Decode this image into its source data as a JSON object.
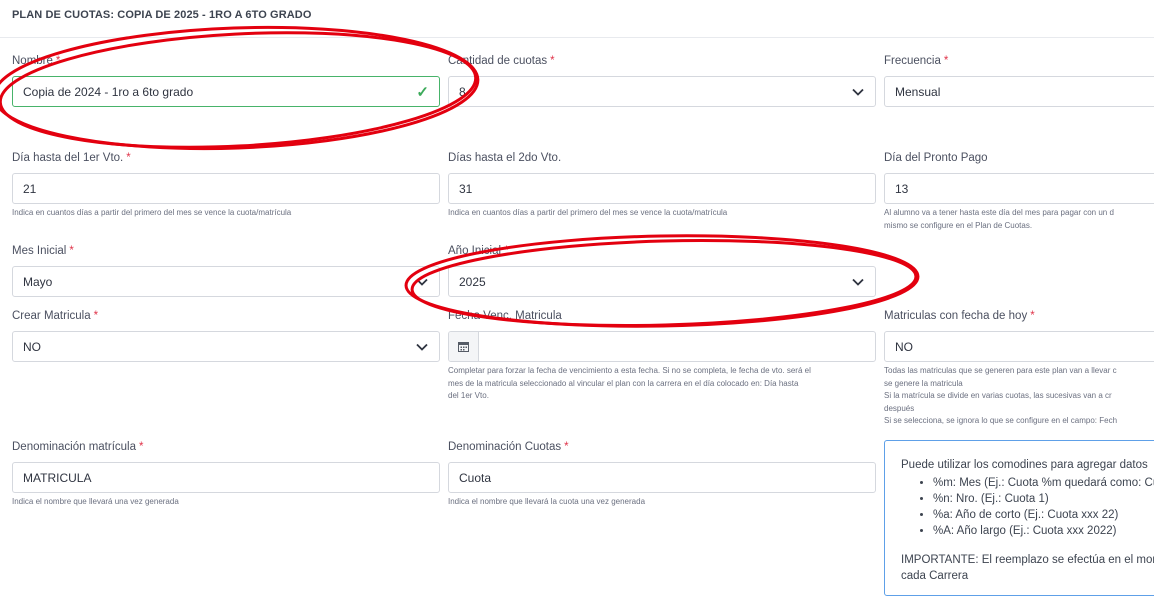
{
  "page": {
    "title": "PLAN DE CUOTAS: COPIA DE 2025 - 1RO A 6TO GRADO"
  },
  "fields": {
    "nombre": {
      "label": "Nombre",
      "required": "*",
      "value": "Copia de 2024 - 1ro a 6to grado"
    },
    "cantidad_cuotas": {
      "label": "Cantidad de cuotas",
      "required": "*",
      "value": "8"
    },
    "frecuencia": {
      "label": "Frecuencia",
      "required": "*",
      "value": "Mensual"
    },
    "dia_1er_vto": {
      "label": "Día hasta del 1er Vto.",
      "required": "*",
      "value": "21",
      "help": "Indica en cuantos días a partir del primero del mes se vence la cuota/matrícula"
    },
    "dias_2do_vto": {
      "label": "Días hasta el 2do Vto.",
      "value": "31",
      "help": "Indica en cuantos días a partir del primero del mes se vence la cuota/matrícula"
    },
    "dia_pronto_pago": {
      "label": "Día del Pronto Pago",
      "value": "13",
      "help_line1": "Al alumno va a tener hasta este día del mes para pagar con un d",
      "help_line2": "mismo se configure en el Plan de Cuotas."
    },
    "mes_inicial": {
      "label": "Mes Inicial",
      "required": "*",
      "value": "Mayo"
    },
    "anio_inicial": {
      "label": "Año Inicial",
      "required": "*",
      "value": "2025"
    },
    "crear_matricula": {
      "label": "Crear Matricula",
      "required": "*",
      "value": "NO"
    },
    "fecha_venc_matricula": {
      "label": "Fecha Venc. Matricula",
      "value": "",
      "help_line1": "Completar para forzar la fecha de vencimiento a esta fecha. Si no se completa, le fecha de vto. será el",
      "help_line2": "mes de la matricula seleccionado al vincular el plan con la carrera en el día colocado en: Día hasta",
      "help_line3": "del 1er Vto."
    },
    "matriculas_fecha_hoy": {
      "label": "Matriculas con fecha de hoy",
      "required": "*",
      "value": "NO",
      "help_line1": "Todas las matriculas que se generen para este plan van a llevar c",
      "help_line2": "se genere la matricula",
      "help_line3": "Si la matrícula se divide en varias cuotas, las sucesivas van a cr",
      "help_line4": "después",
      "help_line5": "Si se selecciona, se ignora lo que se configure en el campo: Fech"
    },
    "denominacion_matricula": {
      "label": "Denominación matrícula",
      "required": "*",
      "value": "MATRICULA",
      "help": "Indica el nombre que llevará una vez generada"
    },
    "denominacion_cuotas": {
      "label": "Denominación Cuotas",
      "required": "*",
      "value": "Cuota",
      "help": "Indica el nombre que llevará la cuota una vez generada"
    }
  },
  "info_box": {
    "intro": "Puede utilizar los comodines para agregar datos",
    "items": [
      "%m: Mes (Ej.: Cuota %m quedará como: Cu",
      "%n: Nro. (Ej.: Cuota 1)",
      "%a: Año de corto (Ej.: Cuota xxx 22)",
      "%A: Año largo (Ej.: Cuota xxx 2022)"
    ],
    "important_line1": "IMPORTANTE: El reemplazo se efectúa en el mome",
    "important_line2": "cada Carrera"
  },
  "colors": {
    "annotation": "#e3000f",
    "valid": "#48b36a",
    "info_border": "#5ea0e8",
    "required": "#e0344a"
  },
  "icons": {
    "valid": "check-icon",
    "dropdown": "chevron-down-icon",
    "date": "calendar-icon"
  }
}
